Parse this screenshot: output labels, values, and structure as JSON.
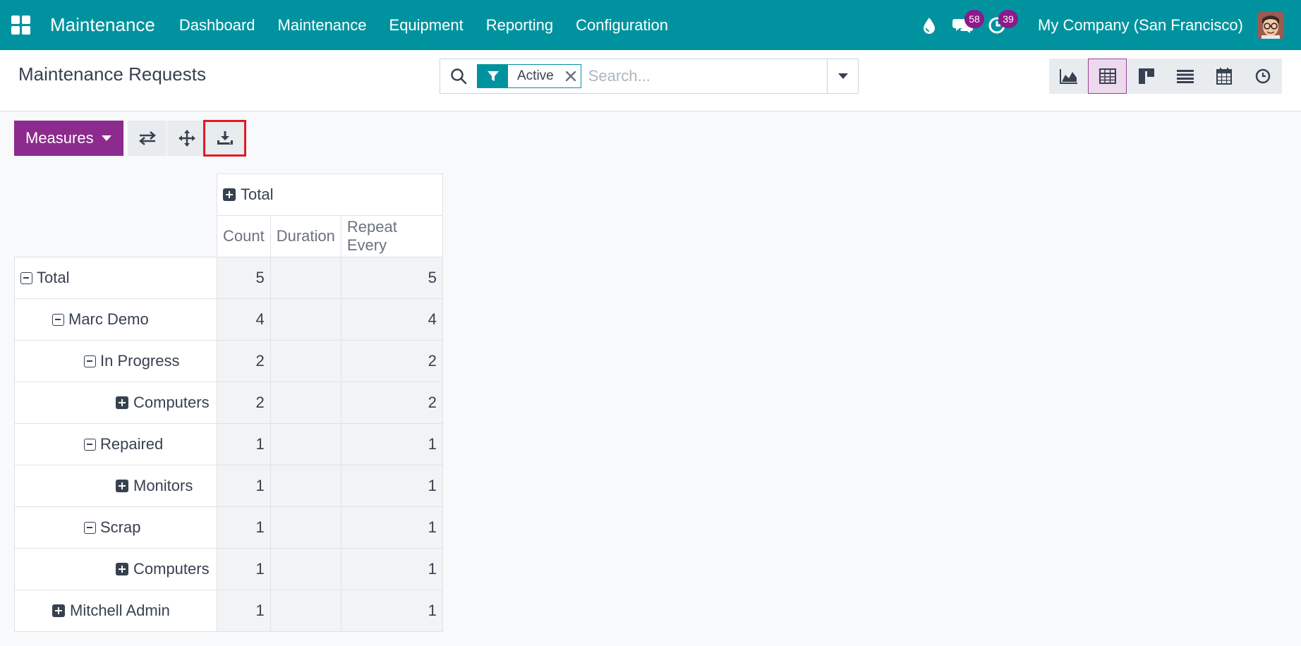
{
  "navbar": {
    "brand": "Maintenance",
    "menu": [
      "Dashboard",
      "Maintenance",
      "Equipment",
      "Reporting",
      "Configuration"
    ],
    "messages_count": "58",
    "activities_count": "39",
    "company": "My Company (San Francisco)"
  },
  "control_panel": {
    "title": "Maintenance Requests",
    "facet_label": "Active",
    "search_placeholder": "Search..."
  },
  "toolbar": {
    "measures_label": "Measures"
  },
  "pivot": {
    "col_group": "Total",
    "measures": [
      "Count",
      "Duration",
      "Repeat Every"
    ],
    "rows": [
      {
        "label": "Total",
        "icon": "collapse",
        "count": "5",
        "duration": "",
        "repeat": "5"
      },
      {
        "label": "Marc Demo",
        "icon": "collapse",
        "count": "4",
        "duration": "",
        "repeat": "4"
      },
      {
        "label": "In Progress",
        "icon": "collapse",
        "count": "2",
        "duration": "",
        "repeat": "2"
      },
      {
        "label": "Computers",
        "icon": "expand",
        "count": "2",
        "duration": "",
        "repeat": "2"
      },
      {
        "label": "Repaired",
        "icon": "collapse",
        "count": "1",
        "duration": "",
        "repeat": "1"
      },
      {
        "label": "Monitors",
        "icon": "expand",
        "count": "1",
        "duration": "",
        "repeat": "1"
      },
      {
        "label": "Scrap",
        "icon": "collapse",
        "count": "1",
        "duration": "",
        "repeat": "1"
      },
      {
        "label": "Computers",
        "icon": "expand",
        "count": "1",
        "duration": "",
        "repeat": "1"
      },
      {
        "label": "Mitchell Admin",
        "icon": "expand",
        "count": "1",
        "duration": "",
        "repeat": "1"
      }
    ]
  },
  "colors": {
    "navbar": "#00939f",
    "primary": "#8d2a8d",
    "badge": "#8b1a8b",
    "highlight": "#e01b24"
  }
}
